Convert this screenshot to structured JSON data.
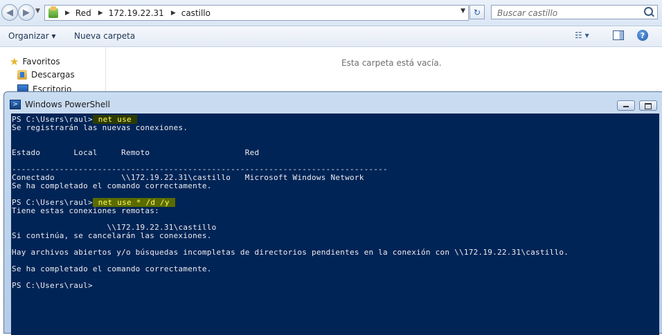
{
  "explorer": {
    "breadcrumb": [
      "Red",
      "172.19.22.31",
      "castillo"
    ],
    "search_placeholder": "Buscar castillo",
    "toolbar": {
      "organize_label": "Organizar ▾",
      "new_folder_label": "Nueva carpeta"
    },
    "nav": {
      "favorites": "Favoritos",
      "downloads": "Descargas",
      "desktop": "Escritorio"
    },
    "empty_message": "Esta carpeta está vacía."
  },
  "powershell": {
    "title": "Windows PowerShell",
    "lines": [
      {
        "prompt": "PS C:\\Users\\raul>",
        "command": " net use "
      },
      {
        "text": "Se registrarán las nuevas conexiones."
      },
      {
        "text": "Estado       Local     Remoto                    Red"
      },
      {
        "text": "-------------------------------------------------------------------------------"
      },
      {
        "text": "Conectado              \\\\172.19.22.31\\castillo   Microsoft Windows Network"
      },
      {
        "text": "Se ha completado el comando correctamente."
      },
      {
        "prompt": "PS C:\\Users\\raul>",
        "command": " net use * /d /y "
      },
      {
        "text": "Tiene estas conexiones remotas:"
      },
      {
        "text": "                    \\\\172.19.22.31\\castillo"
      },
      {
        "text": "Si continúa, se cancelarán las conexiones."
      },
      {
        "text": "Hay archivos abiertos y/o búsquedas incompletas de directorios pendientes en la conexión con \\\\172.19.22.31\\castillo."
      },
      {
        "text": "Se ha completado el comando correctamente."
      },
      {
        "text": "PS C:\\Users\\raul>"
      }
    ]
  }
}
